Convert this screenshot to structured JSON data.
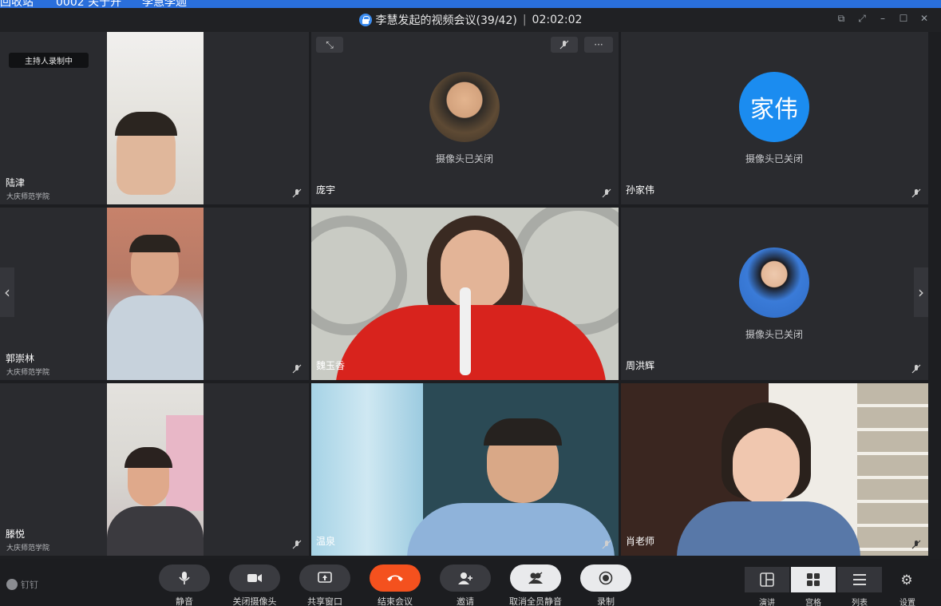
{
  "taskbar": {
    "left_text": "回收站",
    "mid_text": "0002 关于开",
    "right_text": "李慧李迦"
  },
  "window": {
    "title": "李慧发起的视频会议(39/42)",
    "separator": "|",
    "timer": "02:02:02"
  },
  "recording_badge": "主持人录制中",
  "camera_off_text": "摄像头已关闭",
  "participants": [
    {
      "name": "陆津",
      "org": "大庆师范学院"
    },
    {
      "name": "庞宇"
    },
    {
      "name": "孙家伟",
      "avatar_text": "家伟"
    },
    {
      "name": "郭崇林",
      "org": "大庆师范学院"
    },
    {
      "name": "魏玉香"
    },
    {
      "name": "周洪辉"
    },
    {
      "name": "滕悦",
      "org": "大庆师范学院"
    },
    {
      "name": "温泉"
    },
    {
      "name": "肖老师"
    }
  ],
  "tile_controls": {
    "more": "···"
  },
  "toolbar": {
    "brand": "钉钉",
    "buttons": [
      {
        "label": "静音",
        "icon": "microphone-icon"
      },
      {
        "label": "关闭摄像头",
        "icon": "video-camera-icon"
      },
      {
        "label": "共享窗口",
        "icon": "share-screen-icon"
      },
      {
        "label": "结束会议",
        "icon": "hang-up-icon"
      },
      {
        "label": "邀请",
        "icon": "invite-user-icon"
      },
      {
        "label": "取消全员静音",
        "icon": "unmute-all-icon"
      },
      {
        "label": "录制",
        "icon": "record-icon"
      }
    ],
    "views": [
      {
        "label": "演讲",
        "icon": "speaker-view-icon"
      },
      {
        "label": "宫格",
        "icon": "grid-view-icon",
        "active": true
      },
      {
        "label": "列表",
        "icon": "list-view-icon"
      }
    ],
    "settings_label": "设置"
  },
  "colors": {
    "accent": "#1b8cf0",
    "end_call": "#f4511e",
    "background": "#1d1e21",
    "tile": "#2a2b2f"
  }
}
